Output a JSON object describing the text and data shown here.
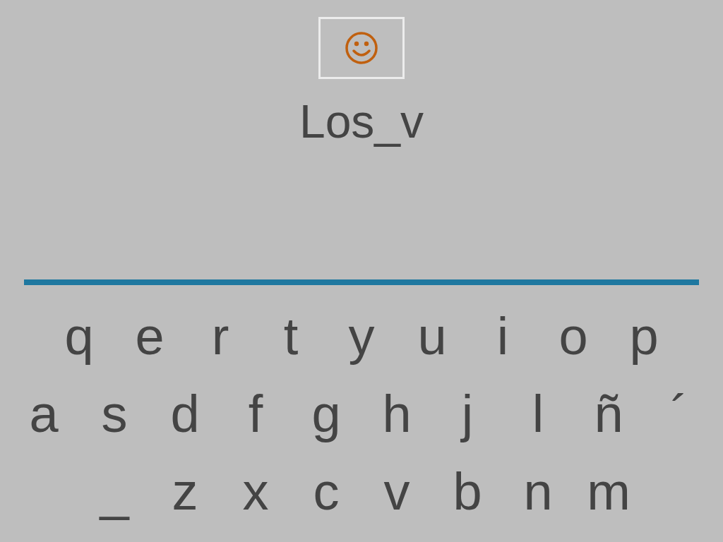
{
  "word": "Los_v",
  "keyboard": [
    [
      "q",
      "e",
      "r",
      "t",
      "y",
      "u",
      "i",
      "o",
      "p"
    ],
    [
      "a",
      "s",
      "d",
      "f",
      "g",
      "h",
      "j",
      "l",
      "ñ",
      "´"
    ],
    [
      "_",
      "z",
      "x",
      "c",
      "v",
      "b",
      "n",
      "m"
    ]
  ]
}
